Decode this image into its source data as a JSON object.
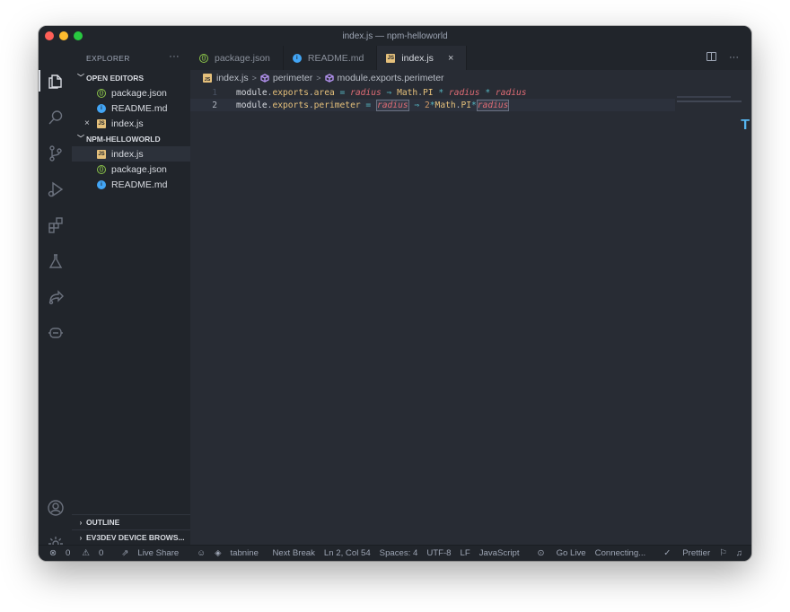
{
  "window": {
    "title": "index.js — npm-helloworld"
  },
  "sidebar": {
    "header": "EXPLORER",
    "more": "···",
    "open_editors": {
      "title": "OPEN EDITORS",
      "items": [
        {
          "label": "package.json",
          "icon": "json-file-icon"
        },
        {
          "label": "README.md",
          "icon": "info-file-icon"
        },
        {
          "label": "index.js",
          "icon": "js-file-icon",
          "close": "×"
        }
      ]
    },
    "project": {
      "title": "NPM-HELLOWORLD",
      "items": [
        {
          "label": "index.js",
          "icon": "js-file-icon"
        },
        {
          "label": "package.json",
          "icon": "json-file-icon"
        },
        {
          "label": "README.md",
          "icon": "info-file-icon"
        }
      ]
    },
    "outline": "OUTLINE",
    "ev3dev": "EV3DEV DEVICE BROWS..."
  },
  "tabs": [
    {
      "label": "package.json",
      "icon": "json-file-icon"
    },
    {
      "label": "README.md",
      "icon": "info-file-icon"
    },
    {
      "label": "index.js",
      "icon": "js-file-icon",
      "close": "×"
    }
  ],
  "tab_more": "···",
  "breadcrumb": {
    "file": "index.js",
    "symbol1": "perimeter",
    "symbol2": "module.exports.perimeter"
  },
  "editor": {
    "lines": [
      {
        "number": "1"
      },
      {
        "number": "2"
      }
    ],
    "cursor_marker": "T"
  },
  "statusbar": {
    "errors": "0",
    "warnings": "0",
    "live_share": "Live Share",
    "tabnine": "tabnine",
    "next_break": "Next Break",
    "position": "Ln 2, Col 54",
    "spaces": "Spaces: 4",
    "encoding": "UTF-8",
    "eol": "LF",
    "language": "JavaScript",
    "go_live": "Go Live",
    "connecting": "Connecting...",
    "prettier": "Prettier"
  },
  "colors": {
    "background": "#282c34",
    "sidebar": "#21252b",
    "accent_property": "#e5c07b",
    "accent_param": "#e06c75",
    "accent_operator": "#56b6c2"
  }
}
